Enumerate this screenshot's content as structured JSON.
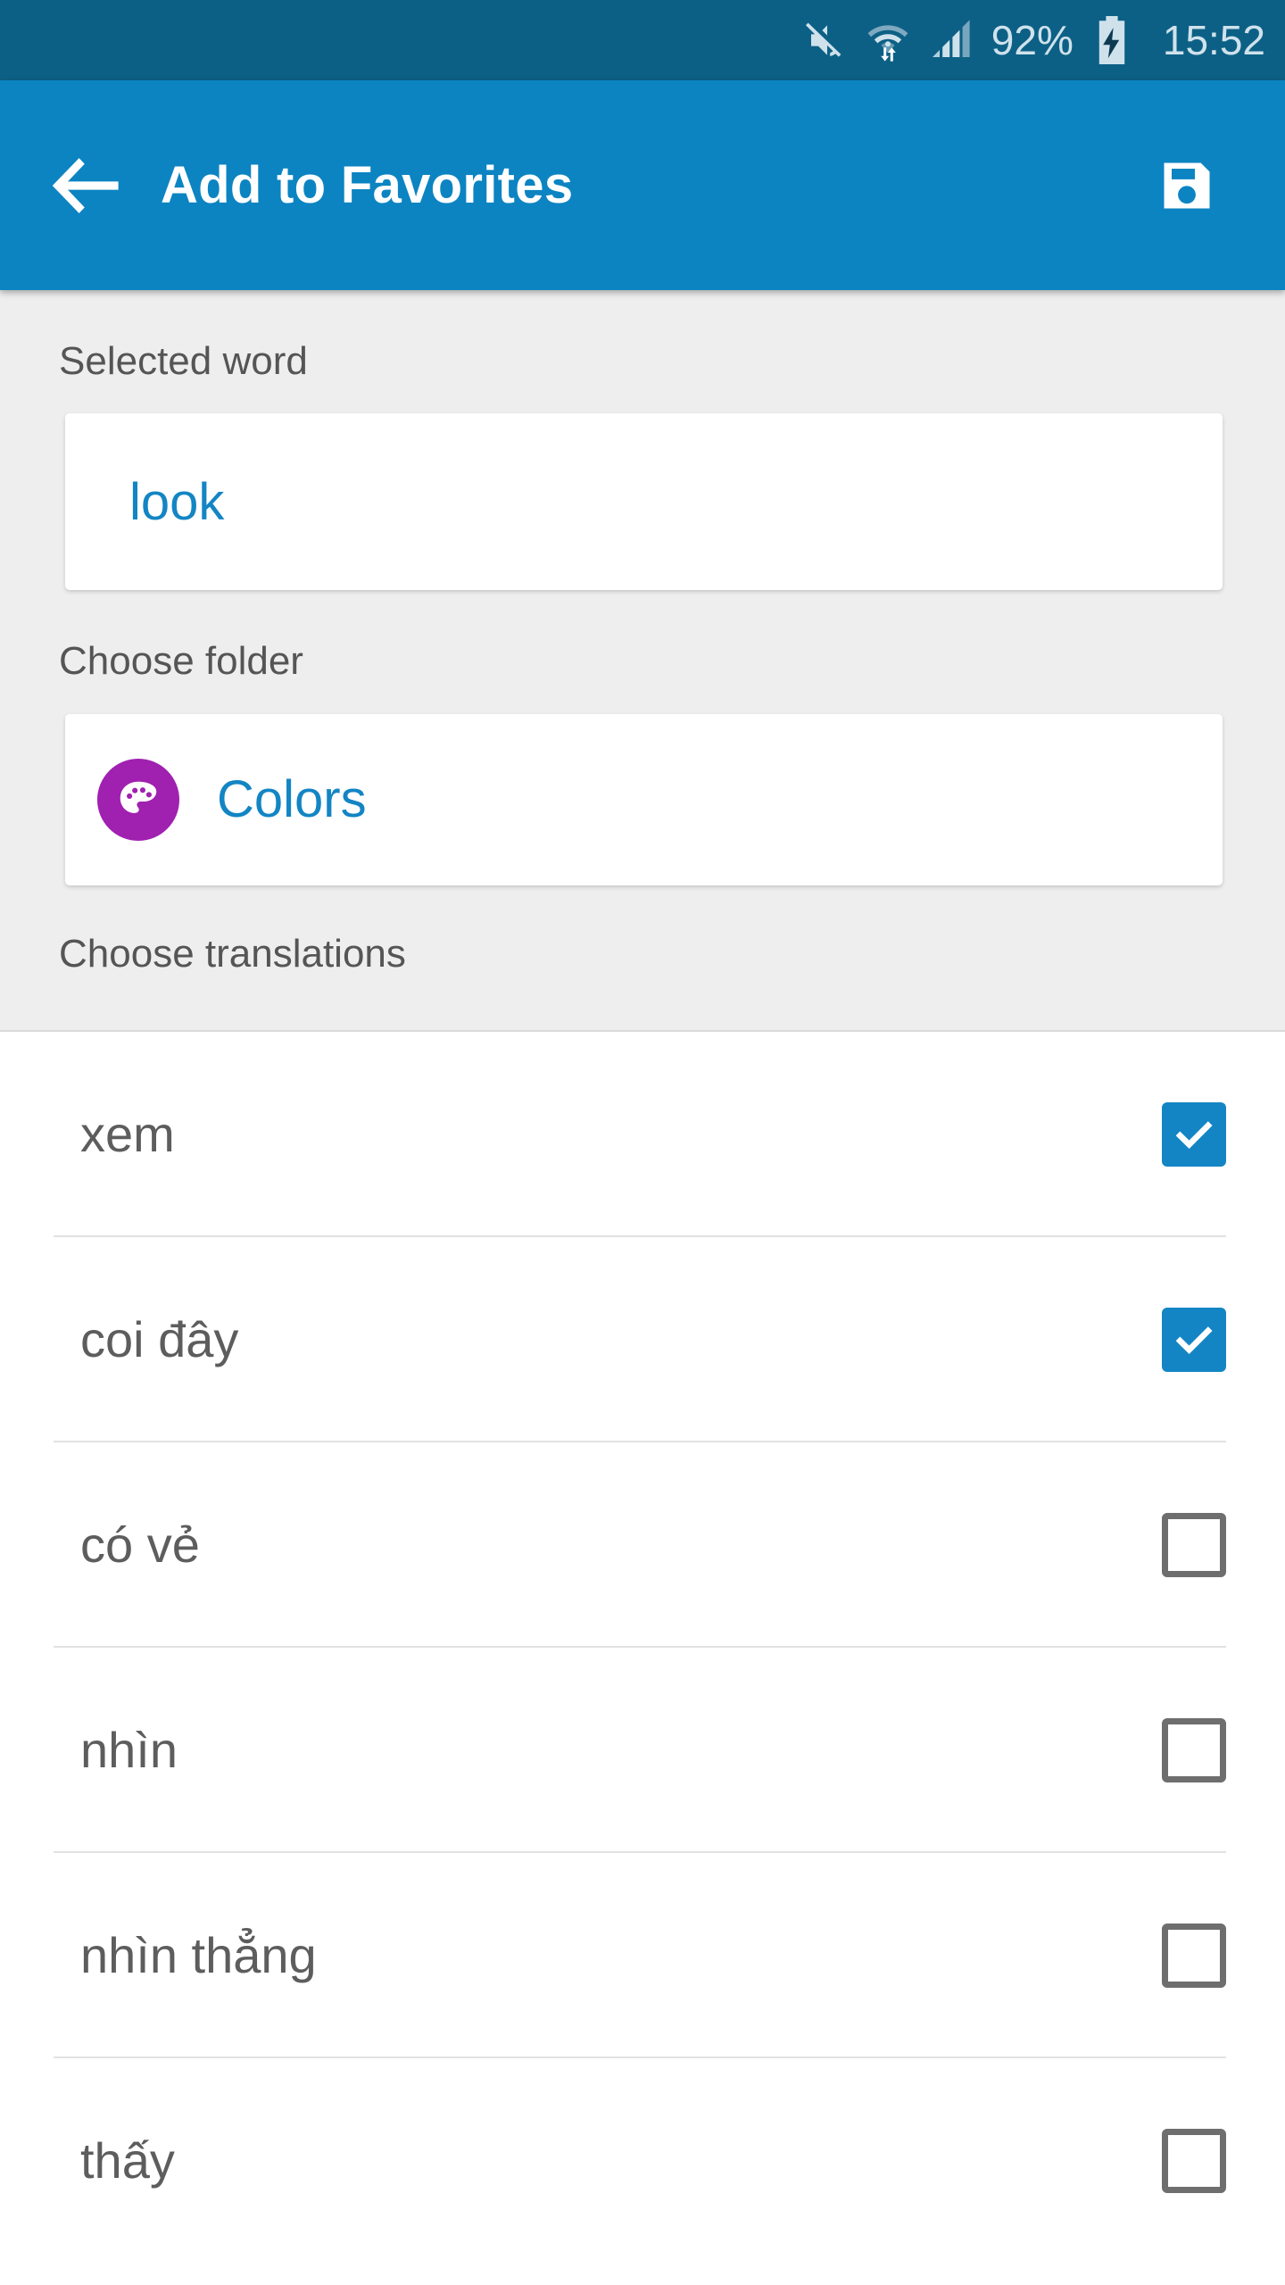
{
  "status_bar": {
    "icons": [
      "mute-icon",
      "wifi-icon",
      "signal-icon"
    ],
    "battery_percent": "92%",
    "battery_state": "charging",
    "time": "15:52",
    "background_color": "#0d6085",
    "text_color": "#cfe2ec"
  },
  "app_bar": {
    "back_icon": "arrow-left-icon",
    "title": "Add to Favorites",
    "save_icon": "save-floppy-icon",
    "background_color": "#0c84c2"
  },
  "form": {
    "selected_word": {
      "label": "Selected word",
      "value": "look",
      "value_color": "#1385c4"
    },
    "folder": {
      "label": "Choose folder",
      "name": "Colors",
      "icon": "palette-icon",
      "avatar_color": "#a020b0",
      "name_color": "#1385c4"
    },
    "translations_label": "Choose translations"
  },
  "translations": [
    {
      "word": "xem",
      "checked": true
    },
    {
      "word": "coi đây",
      "checked": true
    },
    {
      "word": "có vẻ",
      "checked": false
    },
    {
      "word": "nhìn",
      "checked": false
    },
    {
      "word": "nhìn thẳng",
      "checked": false
    },
    {
      "word": "thấy",
      "checked": false
    }
  ],
  "colors": {
    "accent": "#1385c4",
    "app_bar": "#0c84c2",
    "status_bar": "#0d6085",
    "section_bg": "#eeeeee",
    "checkbox_on": "#1385c4",
    "checkbox_off_border": "#6e6e6e",
    "text_primary": "#5d5d5d",
    "text_label": "#555555"
  }
}
